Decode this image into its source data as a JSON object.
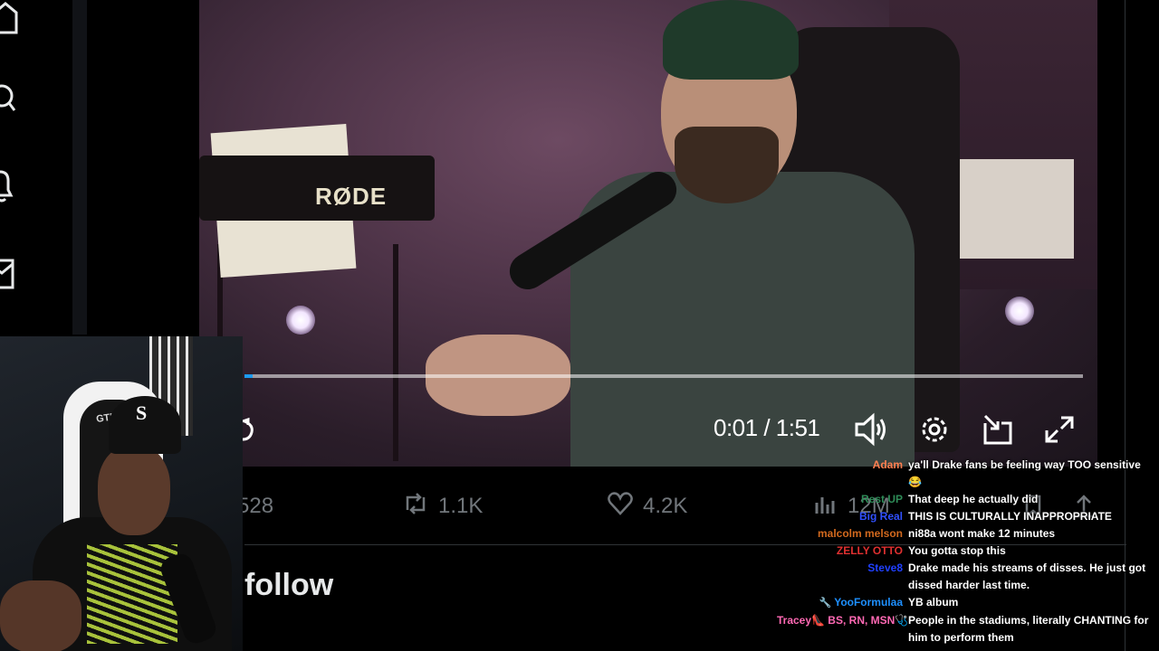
{
  "nav": {
    "items": [
      {
        "name": "home-icon"
      },
      {
        "name": "search-icon"
      },
      {
        "name": "notifications-icon"
      },
      {
        "name": "messages-icon"
      }
    ]
  },
  "video": {
    "mic_brand": "RØDE",
    "timecode": "0:01 / 1:51",
    "progress_fraction": 0.01,
    "controls": [
      "volume-icon",
      "settings-icon",
      "pip-icon",
      "fullscreen-icon"
    ]
  },
  "tweet": {
    "replies": "528",
    "reposts": "1.1K",
    "likes": "4.2K",
    "views": "12M",
    "follow_label": "follow"
  },
  "webcam": {
    "chair_brand": "GTRACING",
    "cap_logo": "S"
  },
  "chat": {
    "messages": [
      {
        "user": "Adam",
        "color": "#ff7f50",
        "badge": "",
        "text": "ya'll Drake fans be feeling way TOO sensitive 😂"
      },
      {
        "user": "Rest UP",
        "color": "#2e8b57",
        "badge": "",
        "text": "That deep he actually did"
      },
      {
        "user": "Big Real",
        "color": "#3050ff",
        "badge": "",
        "text": "THIS IS CULTURALLY INAPPROPRIATE"
      },
      {
        "user": "malcolm melson",
        "color": "#d2691e",
        "badge": "",
        "text": "ni88a wont make 12 minutes"
      },
      {
        "user": "ZELLY OTTO",
        "color": "#e03030",
        "badge": "",
        "text": "You gotta stop this"
      },
      {
        "user": "Steve8",
        "color": "#2040ff",
        "badge": "",
        "text": "Drake made his streams of disses. He just got dissed harder last time."
      },
      {
        "user": "YooFormulaa",
        "color": "#1e90ff",
        "badge": "🔧",
        "text": "YB album"
      },
      {
        "user": "Tracey👠 BS, RN, MSN🩺",
        "color": "#ff69b4",
        "badge": "",
        "text": "People in the stadiums, literally CHANTING for him to perform them"
      }
    ]
  }
}
